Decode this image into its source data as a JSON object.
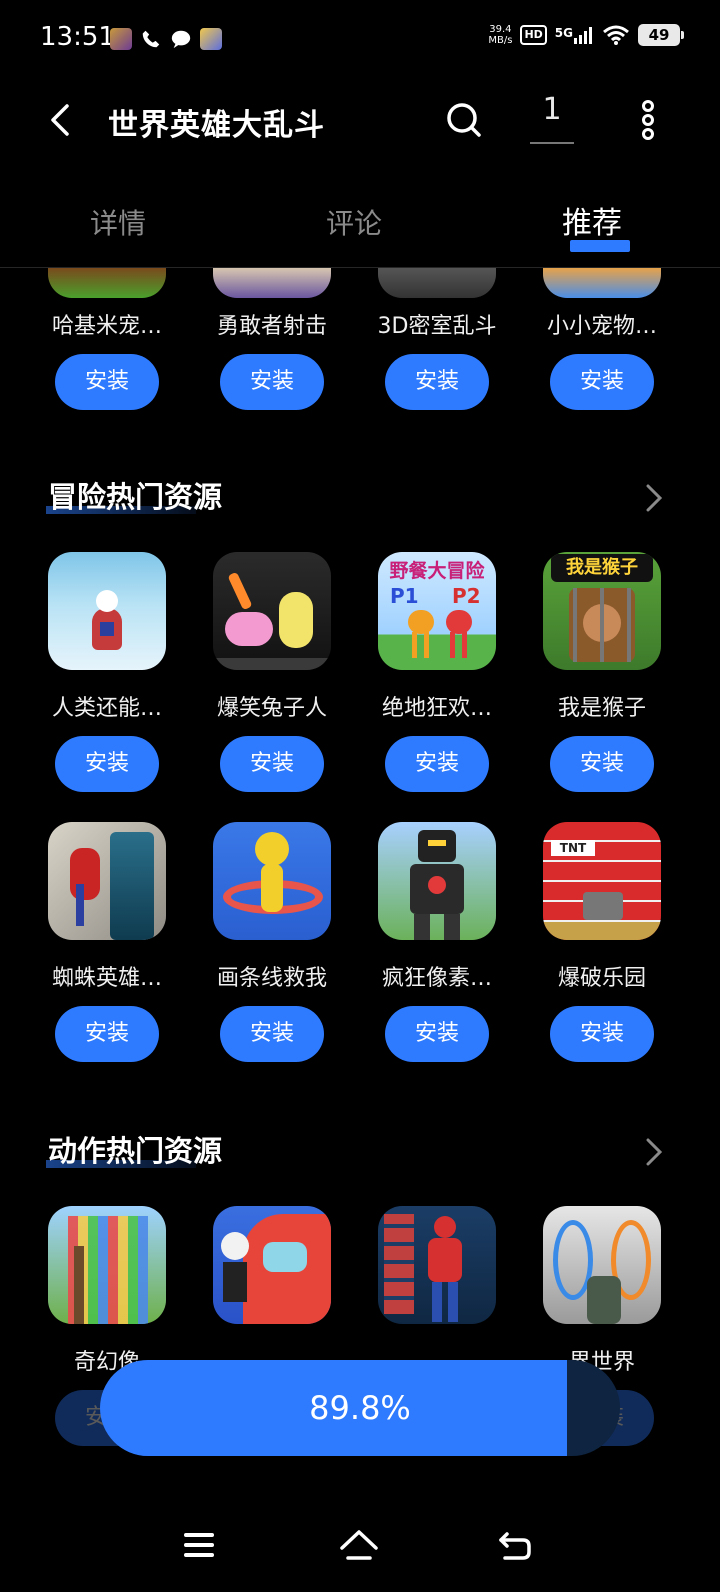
{
  "status_bar": {
    "time": "13:51",
    "net_speed_value": "39.4",
    "net_speed_unit": "MB/s",
    "hd": "HD",
    "network": "5G",
    "battery": "49"
  },
  "header": {
    "title": "世界英雄大乱斗",
    "download_count": "1"
  },
  "tabs": [
    {
      "label": "详情",
      "active": false
    },
    {
      "label": "评论",
      "active": false
    },
    {
      "label": "推荐",
      "active": true
    }
  ],
  "top_row": [
    {
      "name": "哈基米宠…",
      "install_label": "安装"
    },
    {
      "name": "勇敢者射击",
      "install_label": "安装"
    },
    {
      "name": "3D密室乱斗",
      "install_label": "安装"
    },
    {
      "name": "小小宠物…",
      "install_label": "安装"
    }
  ],
  "section_adventure": {
    "title": "冒险热门资源",
    "row1": [
      {
        "name": "人类还能…",
        "install_label": "安装",
        "icon_text": ""
      },
      {
        "name": "爆笑兔子人",
        "install_label": "安装",
        "icon_text": ""
      },
      {
        "name": "绝地狂欢…",
        "install_label": "安装",
        "icon_text": "野餐大冒险",
        "icon_sub1": "P1",
        "icon_sub2": "P2"
      },
      {
        "name": "我是猴子",
        "install_label": "安装",
        "icon_text": "我是猴子"
      }
    ],
    "row2": [
      {
        "name": "蜘蛛英雄…",
        "install_label": "安装"
      },
      {
        "name": "画条线救我",
        "install_label": "安装"
      },
      {
        "name": "疯狂像素…",
        "install_label": "安装"
      },
      {
        "name": "爆破乐园",
        "install_label": "安装",
        "icon_text": "TNT"
      }
    ]
  },
  "section_action": {
    "title": "动作热门资源",
    "row1": [
      {
        "name": "奇幻像",
        "install_label": "安装"
      },
      {
        "name": "",
        "install_label": "安装"
      },
      {
        "name": "",
        "install_label": "安装"
      },
      {
        "name": "界世界",
        "install_label": "安装"
      }
    ]
  },
  "download_progress": {
    "percent_label": "89.8%",
    "fraction": 0.898
  }
}
